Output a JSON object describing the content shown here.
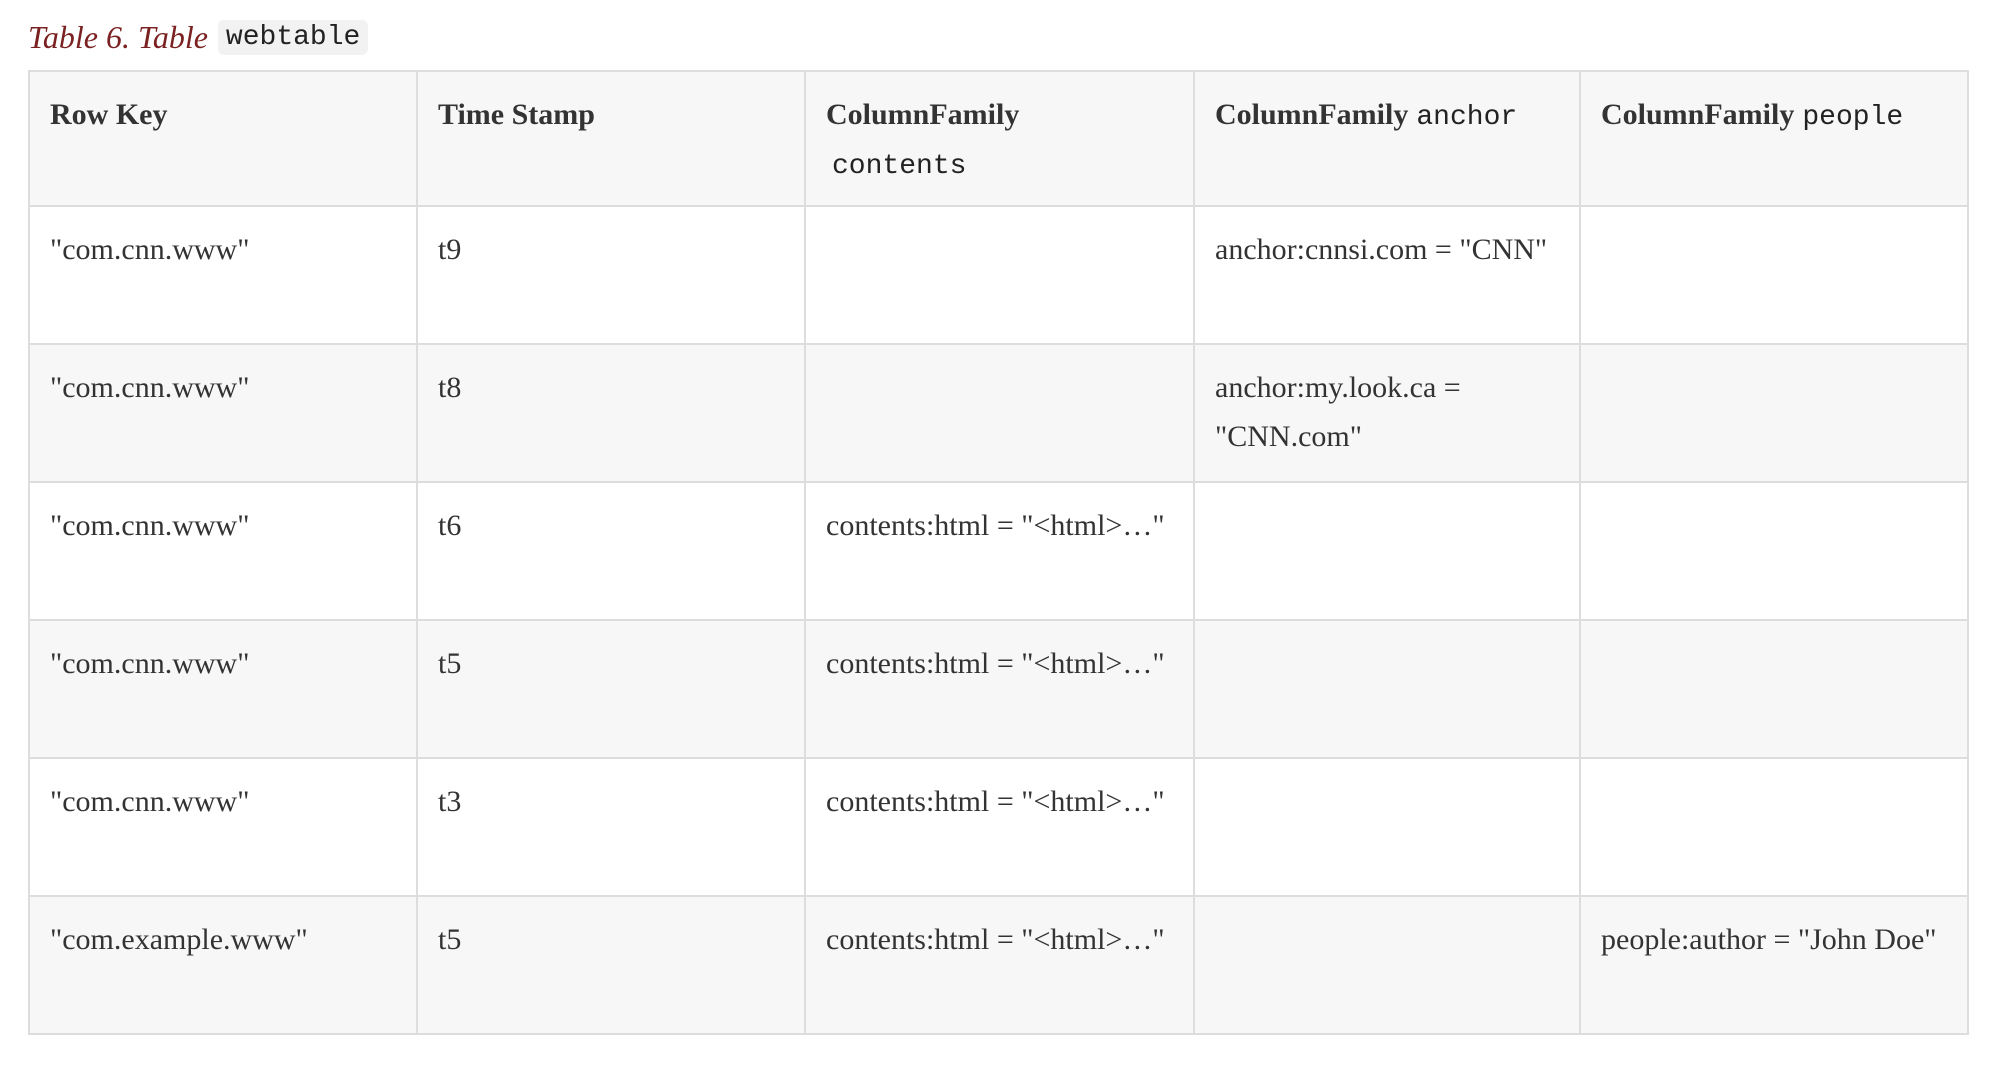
{
  "caption": {
    "label": "Table 6. Table",
    "code": "webtable"
  },
  "table": {
    "headers": [
      {
        "text": "Row Key",
        "code": ""
      },
      {
        "text": "Time Stamp",
        "code": ""
      },
      {
        "text": "ColumnFamily",
        "code": "contents"
      },
      {
        "text": "ColumnFamily",
        "code": "anchor"
      },
      {
        "text": "ColumnFamily",
        "code": "people"
      }
    ],
    "rows": [
      [
        "\"com.cnn.www\"",
        "t9",
        "",
        "anchor:cnnsi.com = \"CNN\"",
        ""
      ],
      [
        "\"com.cnn.www\"",
        "t8",
        "",
        "anchor:my.look.ca = \"CNN.com\"",
        ""
      ],
      [
        "\"com.cnn.www\"",
        "t6",
        "contents:html = \"<html>…\"",
        "",
        ""
      ],
      [
        "\"com.cnn.www\"",
        "t5",
        "contents:html = \"<html>…\"",
        "",
        ""
      ],
      [
        "\"com.cnn.www\"",
        "t3",
        "contents:html = \"<html>…\"",
        "",
        ""
      ],
      [
        "\"com.example.www\"",
        "t5",
        "contents:html = \"<html>…\"",
        "",
        "people:author = \"John Doe\""
      ]
    ]
  }
}
